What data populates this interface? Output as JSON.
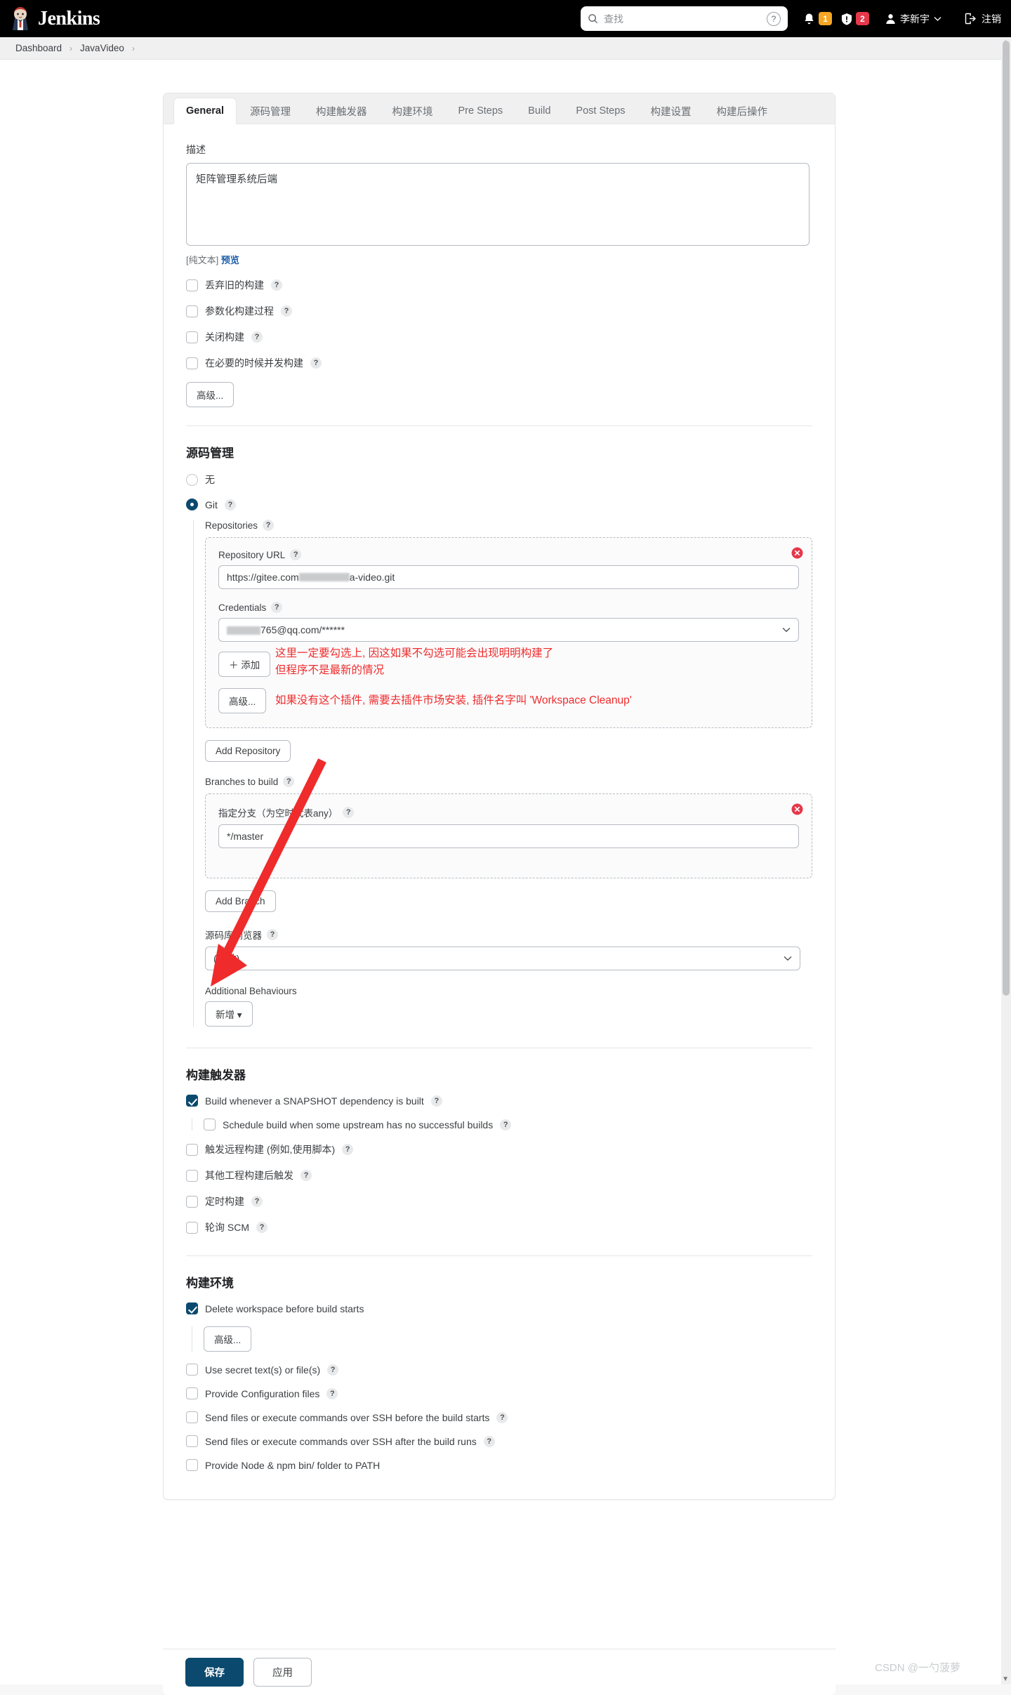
{
  "header": {
    "brand": "Jenkins",
    "logo_icon": "jenkins-butler-icon",
    "search_placeholder": "查找",
    "search_icon": "search-icon",
    "search_help_icon": "question-mark-icon",
    "bell_icon": "bell-icon",
    "bell_count": "1",
    "shield_icon": "shield-alert-icon",
    "shield_count": "2",
    "user_icon": "person-icon",
    "user_name": "李新宇",
    "user_chevron_icon": "chevron-down-icon",
    "logout_icon": "logout-icon",
    "logout_label": "注销",
    "badge_warn_color": "#f5a623",
    "badge_err_color": "#e5384b"
  },
  "breadcrumb": {
    "items": [
      "Dashboard",
      "JavaVideo"
    ],
    "separator": "›"
  },
  "tabs": [
    {
      "label": "General",
      "active": true
    },
    {
      "label": "源码管理",
      "active": false
    },
    {
      "label": "构建触发器",
      "active": false
    },
    {
      "label": "构建环境",
      "active": false
    },
    {
      "label": "Pre Steps",
      "active": false
    },
    {
      "label": "Build",
      "active": false
    },
    {
      "label": "Post Steps",
      "active": false
    },
    {
      "label": "构建设置",
      "active": false
    },
    {
      "label": "构建后操作",
      "active": false
    }
  ],
  "general": {
    "description_label": "描述",
    "description_value": "矩阵管理系统后端",
    "description_mode": "[纯文本]",
    "description_preview": "预览",
    "checkboxes": [
      {
        "label": "丢弃旧的构建",
        "checked": false,
        "help": "?"
      },
      {
        "label": "参数化构建过程",
        "checked": false,
        "help": "?"
      },
      {
        "label": "关闭构建",
        "checked": false,
        "help": "?"
      },
      {
        "label": "在必要的时候并发构建",
        "checked": false,
        "help": "?"
      }
    ],
    "advanced_button": "高级..."
  },
  "scm": {
    "title": "源码管理",
    "options": [
      {
        "label": "无",
        "selected": false
      },
      {
        "label": "Git",
        "selected": true,
        "help": "?"
      }
    ],
    "repositories_label": "Repositories",
    "repository_url_label": "Repository URL",
    "repository_url_value_prefix": "https://gitee.com",
    "repository_url_value_suffix": "a-video.git",
    "credentials_label": "Credentials",
    "credentials_value_suffix": "765@qq.com/******",
    "add_credentials_button": "添加",
    "add_credentials_icon": "plus-icon",
    "repo_advanced_button": "高级...",
    "add_repository_button": "Add Repository",
    "branches_label": "Branches to build",
    "branch_specifier_label": "指定分支（为空时代表any）",
    "branch_specifier_value": "*/master",
    "add_branch_button": "Add Branch",
    "browser_label": "源码库浏览器",
    "browser_value": "(自动)",
    "additional_behaviours_label": "Additional Behaviours",
    "additional_behaviours_button": "新增",
    "additional_behaviours_icon": "caret-down-icon",
    "remove_icon": "close-circle-icon"
  },
  "triggers": {
    "title": "构建触发器",
    "items": [
      {
        "label": "Build whenever a SNAPSHOT dependency is built",
        "checked": true,
        "indent": 0,
        "help": "?"
      },
      {
        "label": "Schedule build when some upstream has no successful builds",
        "checked": false,
        "indent": 1,
        "help": "?"
      },
      {
        "label": "触发远程构建 (例如,使用脚本)",
        "checked": false,
        "indent": 0,
        "help": "?"
      },
      {
        "label": "其他工程构建后触发",
        "checked": false,
        "indent": 0,
        "help": "?"
      },
      {
        "label": "定时构建",
        "checked": false,
        "indent": 0,
        "help": "?"
      },
      {
        "label": "轮询 SCM",
        "checked": false,
        "indent": 0,
        "help": "?"
      }
    ]
  },
  "build_env": {
    "title": "构建环境",
    "delete_workspace_label": "Delete workspace before build starts",
    "delete_workspace_checked": true,
    "delete_workspace_advanced": "高级...",
    "items": [
      {
        "label": "Use secret text(s) or file(s)",
        "checked": false,
        "help": "?"
      },
      {
        "label": "Provide Configuration files",
        "checked": false,
        "help": "?"
      },
      {
        "label": "Send files or execute commands over SSH before the build starts",
        "checked": false,
        "help": "?"
      },
      {
        "label": "Send files or execute commands over SSH after the build runs",
        "checked": false,
        "help": "?"
      },
      {
        "label": "Provide Node & npm bin/ folder to PATH",
        "checked": false,
        "help": ""
      }
    ]
  },
  "footer": {
    "save_label": "保存",
    "apply_label": "应用"
  },
  "annotations": [
    {
      "text": "这里一定要勾选上, 因这如果不勾选可能会出现明明构建了\n但程序不是最新的情况",
      "color": "#ef2b2b"
    },
    {
      "text": "如果没有这个插件, 需要去插件市场安装, 插件名字叫 'Workspace Cleanup'",
      "color": "#ef2b2b"
    }
  ],
  "watermark": "CSDN @一勺菠萝",
  "scrollbar": {
    "up_icon": "triangle-up-icon",
    "down_icon": "triangle-down-icon"
  }
}
